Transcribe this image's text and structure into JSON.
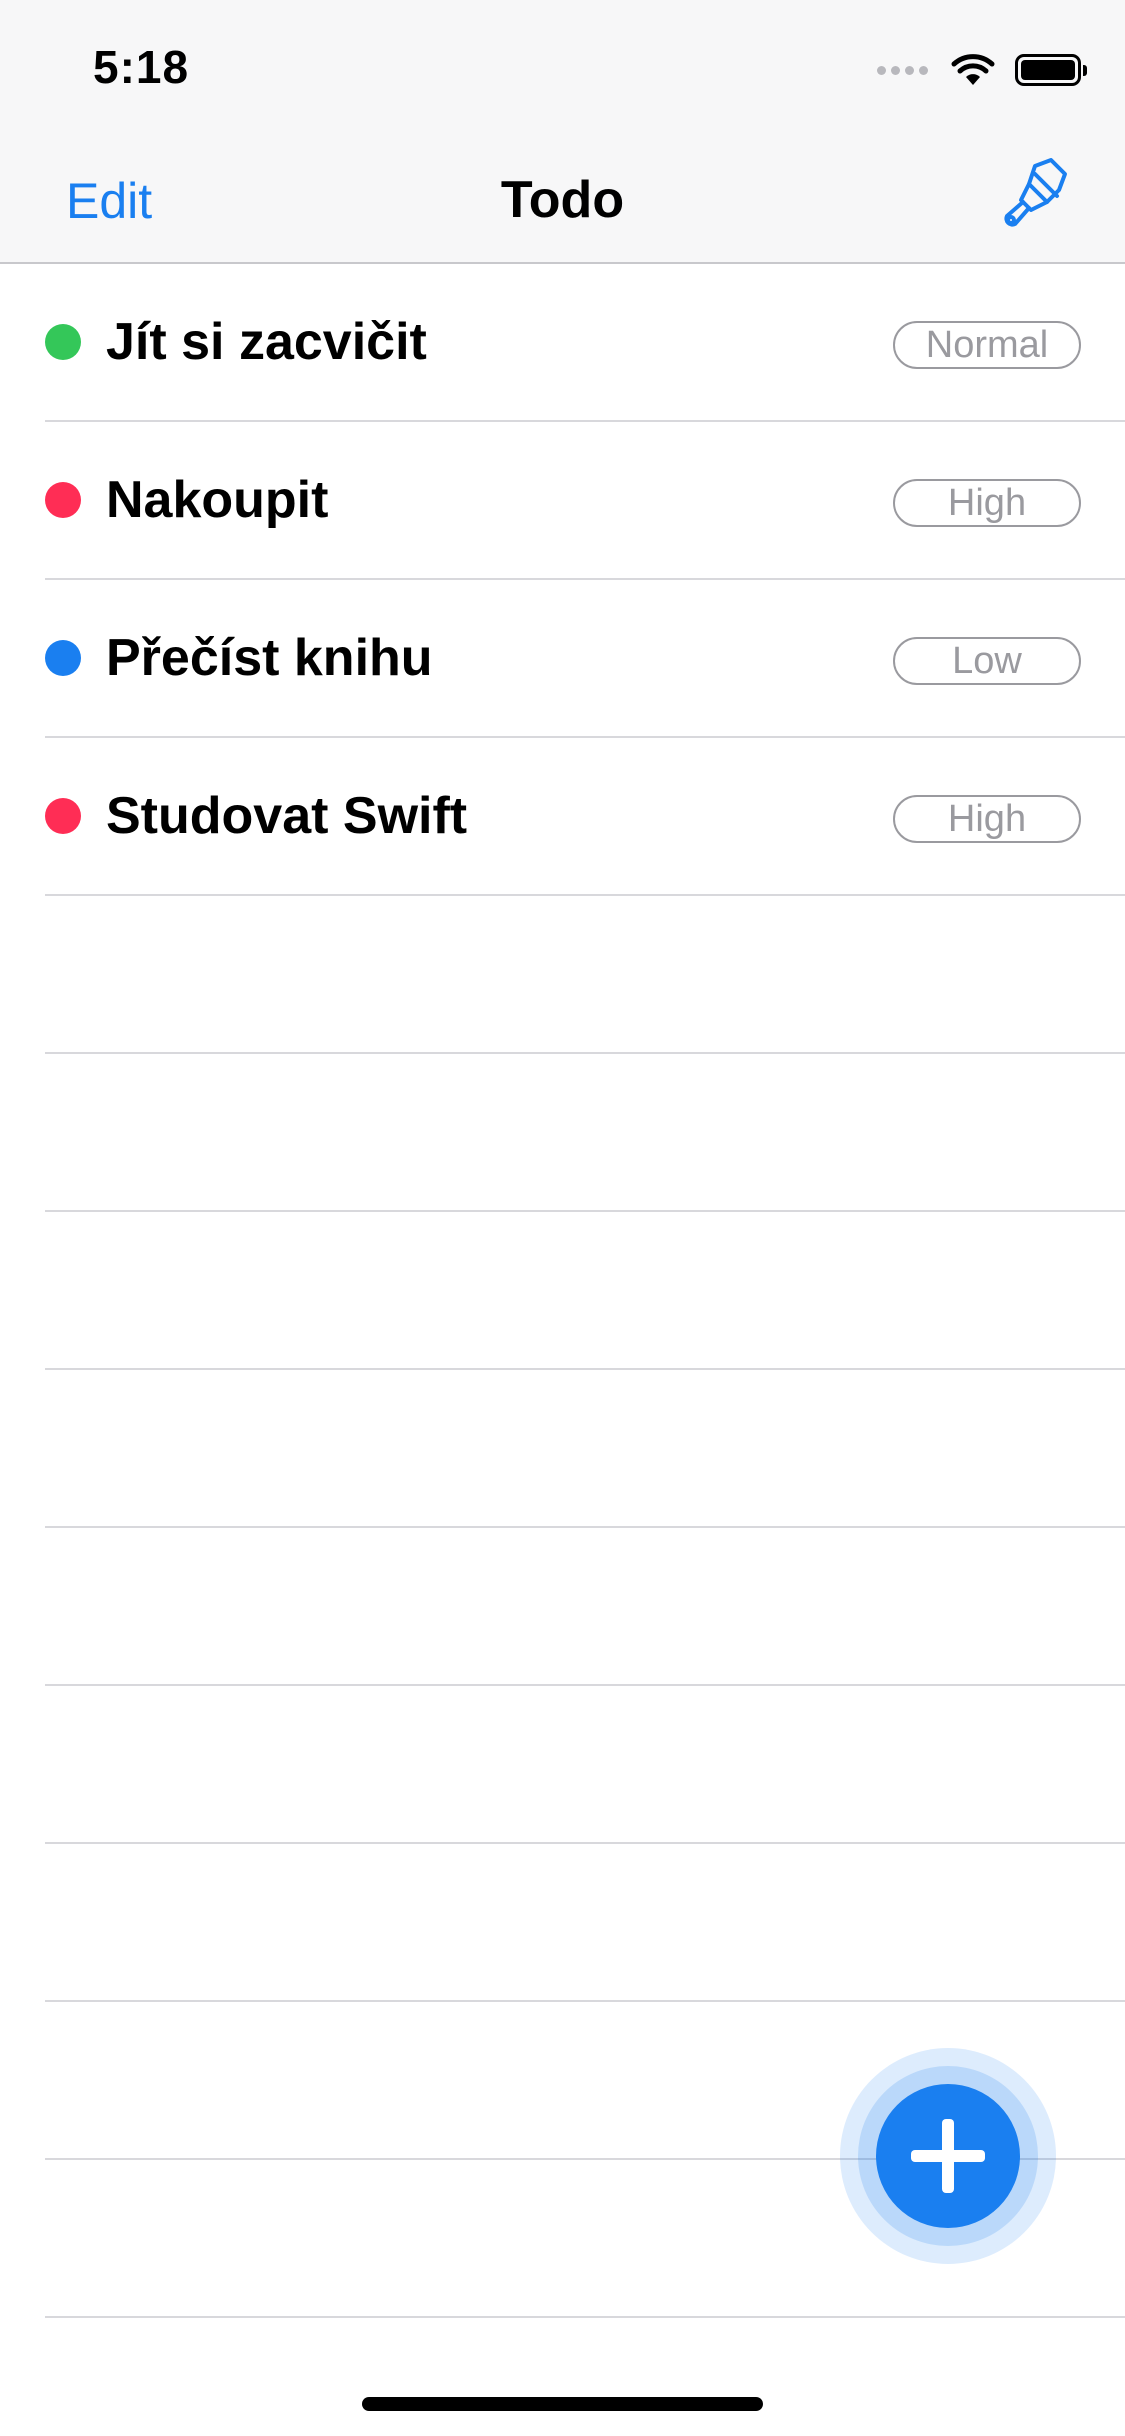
{
  "status_bar": {
    "time": "5:18"
  },
  "nav": {
    "edit_label": "Edit",
    "title": "Todo",
    "right_icon": "paintbrush-icon"
  },
  "colors": {
    "accent": "#1a7ff0",
    "priority_normal": "#34c759",
    "priority_high": "#ff2d55",
    "priority_low": "#1a7ff0"
  },
  "todos": [
    {
      "title": "Jít si zacvičit",
      "priority": "Normal",
      "color": "#34c759"
    },
    {
      "title": "Nakoupit",
      "priority": "High",
      "color": "#ff2d55"
    },
    {
      "title": "Přečíst knihu",
      "priority": "Low",
      "color": "#1a7ff0"
    },
    {
      "title": "Studovat Swift",
      "priority": "High",
      "color": "#ff2d55"
    }
  ],
  "fab": {
    "icon": "plus-icon"
  }
}
